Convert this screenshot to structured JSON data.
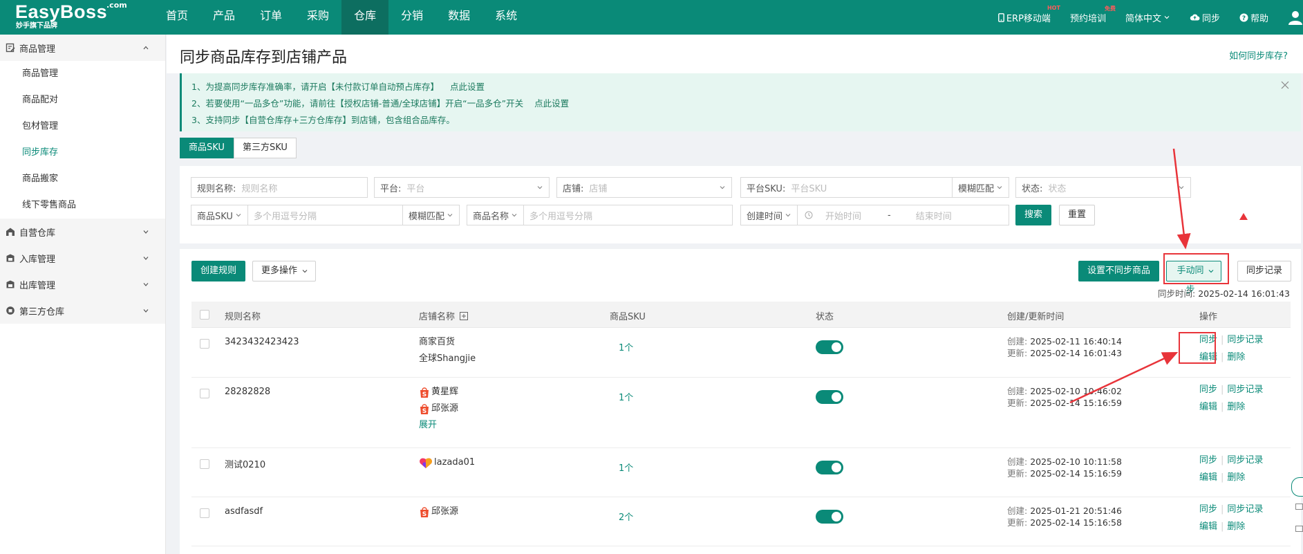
{
  "header": {
    "logo": "EasyBoss",
    "logo_com": ".com",
    "logo_sub": "妙手旗下品牌",
    "nav": [
      "首页",
      "产品",
      "订单",
      "采购",
      "仓库",
      "分销",
      "数据",
      "系统"
    ],
    "right": {
      "erp_mobile": "ERP移动端",
      "erp_badge": "HOT",
      "training": "预约培训",
      "training_badge": "免费",
      "language": "简体中文",
      "sync": "同步",
      "help": "帮助"
    }
  },
  "sidebar": {
    "groups": [
      {
        "label": "商品管理",
        "items": [
          "商品管理",
          "商品配对",
          "包材管理",
          "同步库存",
          "商品搬家",
          "线下零售商品"
        ]
      },
      {
        "label": "自营仓库"
      },
      {
        "label": "入库管理"
      },
      {
        "label": "出库管理"
      },
      {
        "label": "第三方仓库"
      }
    ]
  },
  "page": {
    "title": "同步商品库存到店铺产品",
    "help_link": "如何同步库存?"
  },
  "notice": {
    "line1": "1、为提高同步库存准确率，请开启【未付款订单自动预占库存】",
    "line1_link": "点此设置",
    "line2": "2、若要使用“一品多仓”功能，请前往【授权店铺-普通/全球店铺】开启“一品多仓”开关",
    "line2_link": "点此设置",
    "line3": "3、支持同步【自营仓库存+三方仓库存】到店铺，包含组合品库存。"
  },
  "tabs": [
    "商品SKU",
    "第三方SKU"
  ],
  "filters": {
    "rule_name_label": "规则名称:",
    "rule_name_ph": "规则名称",
    "platform_label": "平台:",
    "platform_ph": "平台",
    "shop_label": "店铺:",
    "shop_ph": "店铺",
    "platform_sku_label": "平台SKU:",
    "platform_sku_ph": "平台SKU",
    "fuzzy": "模糊匹配",
    "status_label": "状态:",
    "status_ph": "状态",
    "product_sku": "商品SKU",
    "multi_ph": "多个用逗号分隔",
    "product_name": "商品名称",
    "created_time": "创建时间",
    "start_ph": "开始时间",
    "dash": "-",
    "end_ph": "结束时间",
    "search": "搜索",
    "reset": "重置"
  },
  "toolbar": {
    "create_rule": "创建规则",
    "more_ops": "更多操作",
    "set_no_sync": "设置不同步商品",
    "manual_sync": "手动同步",
    "sync_records": "同步记录",
    "sync_time_label": "同步时间:",
    "sync_time_value": "2025-02-14 16:01:43"
  },
  "table": {
    "headers": [
      "规则名称",
      "店铺名称",
      "商品SKU",
      "状态",
      "创建/更新时间",
      "操作"
    ],
    "created_k": "创建:",
    "updated_k": "更新:",
    "op_sync": "同步",
    "op_records": "同步记录",
    "op_edit": "编辑",
    "op_delete": "删除",
    "expand": "展开",
    "rows": [
      {
        "name": "3423432423423",
        "shops": [
          "商家百货",
          "全球Shangjie"
        ],
        "sku": "1个",
        "created": "2025-02-11 16:40:14",
        "updated": "2025-02-14 16:01:43"
      },
      {
        "name": "28282828",
        "shops": [
          "黄星辉",
          "邱张源"
        ],
        "sku": "1个",
        "created": "2025-02-10 10:46:02",
        "updated": "2025-02-14 15:16:59"
      },
      {
        "name": "测试0210",
        "shops": [
          "lazada01"
        ],
        "sku": "1个",
        "created": "2025-02-10 10:11:58",
        "updated": "2025-02-14 15:16:59"
      },
      {
        "name": "asdfasdf",
        "shops": [
          "邱张源"
        ],
        "sku": "2个",
        "created": "2025-01-21 20:51:46",
        "updated": "2025-02-14 15:16:58"
      }
    ]
  },
  "colors": {
    "brand": "#0a8a78",
    "annotation": "#e8343a"
  }
}
